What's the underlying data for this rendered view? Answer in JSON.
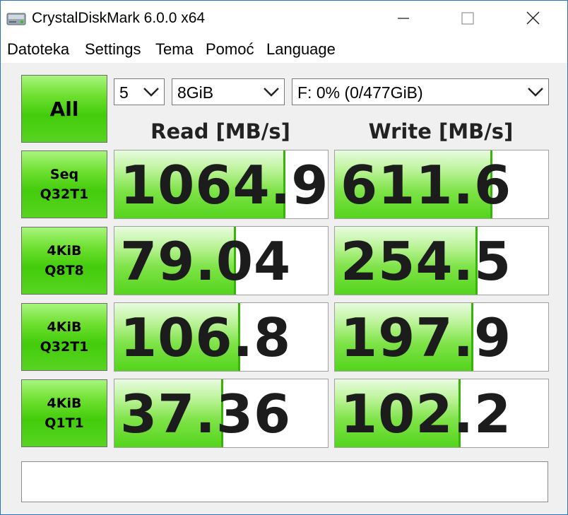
{
  "window": {
    "title": "CrystalDiskMark 6.0.0 x64"
  },
  "menu": {
    "items": [
      "Datoteka",
      "Settings",
      "Tema",
      "Pomoć",
      "Language"
    ]
  },
  "controls": {
    "all_label": "All",
    "count": "5",
    "size": "8GiB",
    "drive": "F: 0% (0/477GiB)"
  },
  "headers": {
    "read": "Read [MB/s]",
    "write": "Write [MB/s]"
  },
  "tests": [
    {
      "line1": "Seq",
      "line2": "Q32T1",
      "read": "1064.9",
      "write": "611.6"
    },
    {
      "line1": "4KiB",
      "line2": "Q8T8",
      "read": "79.04",
      "write": "254.5"
    },
    {
      "line1": "4KiB",
      "line2": "Q32T1",
      "read": "106.8",
      "write": "197.9"
    },
    {
      "line1": "4KiB",
      "line2": "Q1T1",
      "read": "37.36",
      "write": "102.2"
    }
  ],
  "bar_levels": {
    "read": [
      0.8,
      0.57,
      0.59,
      0.51
    ],
    "write": [
      0.74,
      0.67,
      0.65,
      0.59
    ]
  },
  "status_text": "",
  "colors": {
    "bar_green": "#54d41d",
    "button_green": "#43cc0c",
    "window_border": "#2a73b8"
  }
}
